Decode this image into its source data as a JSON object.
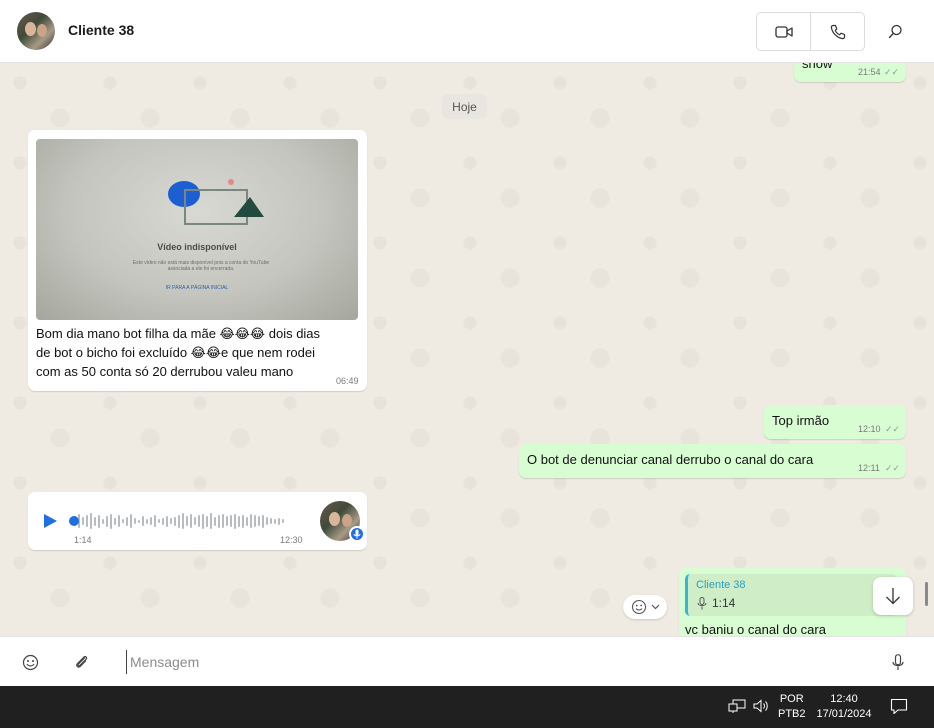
{
  "header": {
    "contact_name": "Cliente 38"
  },
  "chat": {
    "top_partial": {
      "text": "show",
      "time": "21:54"
    },
    "day_label": "Hoje",
    "photo_message": {
      "image_title": "Vídeo indisponível",
      "image_subtitle": "Este vídeo não está mais disponível pois a conta do YouTube associada a ele foi encerrada.",
      "image_link": "IR PARA A PÁGINA INICIAL",
      "caption_lines": [
        "Bom dia mano bot filha da mãe 😂😂😂 dois dias",
        "de bot o bicho foi excluído 😂😂e que nem rodei",
        "com as 50 conta só 20 derrubou valeu mano"
      ],
      "time": "06:49"
    },
    "out_message_1": {
      "text": "Top irmão",
      "time": "12:10"
    },
    "out_message_2": {
      "text": "O bot de denunciar canal derrubo o canal do cara",
      "time": "12:11"
    },
    "voice_message": {
      "duration": "1:14",
      "time": "12:30"
    },
    "reply_message": {
      "quoted_name": "Cliente 38",
      "quoted_duration": "1:14",
      "text": "vc baniu o canal do cara"
    }
  },
  "composer": {
    "placeholder": "Mensagem"
  },
  "taskbar": {
    "lang_top": "POR",
    "lang_bottom": "PTB2",
    "time": "12:40",
    "date": "17/01/2024"
  }
}
